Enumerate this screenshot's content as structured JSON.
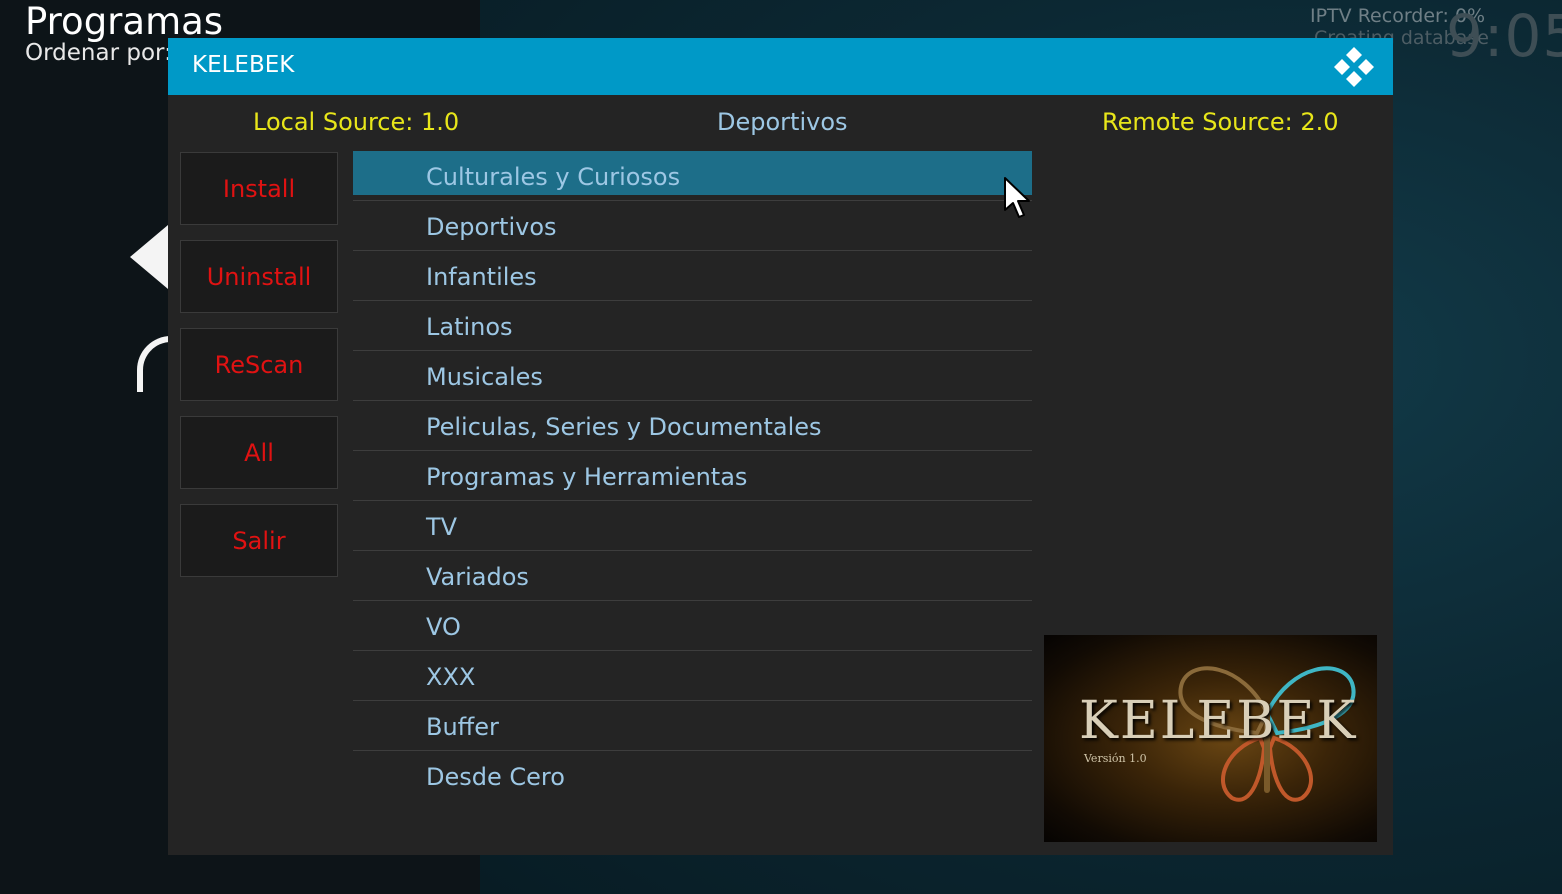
{
  "background": {
    "title": "Programas",
    "sort_label": "Ordenar por:",
    "status_line1": "IPTV Recorder:  0%",
    "status_line2": "Creating database",
    "clock": "9:05"
  },
  "dialog": {
    "title": "KELEBEK",
    "local_source": "Local Source: 1.0",
    "current_category": "Deportivos",
    "remote_source": "Remote Source: 2.0",
    "buttons": [
      {
        "label": "Install"
      },
      {
        "label": "Uninstall"
      },
      {
        "label": "ReScan"
      },
      {
        "label": "All"
      },
      {
        "label": "Salir"
      }
    ],
    "categories": [
      {
        "label": "Culturales y Curiosos",
        "selected": true
      },
      {
        "label": "Deportivos"
      },
      {
        "label": "Infantiles"
      },
      {
        "label": "Latinos"
      },
      {
        "label": "Musicales"
      },
      {
        "label": "Peliculas, Series y Documentales"
      },
      {
        "label": "Programas y Herramientas"
      },
      {
        "label": "TV"
      },
      {
        "label": "Variados"
      },
      {
        "label": "VO"
      },
      {
        "label": "XXX"
      },
      {
        "label": "Buffer"
      },
      {
        "label": "Desde Cero"
      }
    ],
    "preview": {
      "logo_text": "KELEBEK",
      "version_text": "Versión 1.0"
    }
  },
  "colors": {
    "header": "#0099c7",
    "source_text": "#e8e61a",
    "list_text": "#9dc7e4",
    "button_text": "#e01212",
    "selected_row": "#1d6e89"
  },
  "icons": {
    "logo": "kodi-logo-icon",
    "pointer": "mouse-cursor-icon"
  }
}
